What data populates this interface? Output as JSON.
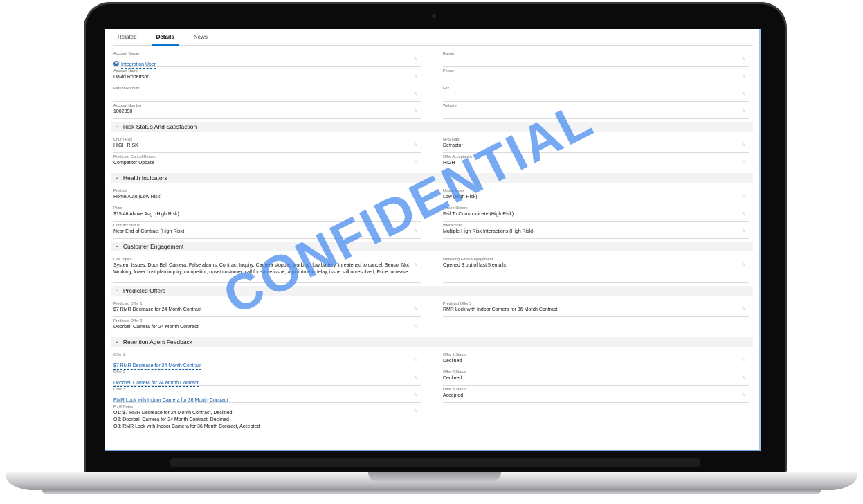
{
  "tabs": [
    {
      "label": "Related"
    },
    {
      "label": "Details"
    },
    {
      "label": "News"
    }
  ],
  "account": {
    "owner_label": "Account Owner",
    "owner_value": "Integration User",
    "rating_label": "Rating",
    "rating_value": "",
    "name_label": "Account Name",
    "name_value": "David Robertson",
    "phone_label": "Phone",
    "phone_value": "",
    "parent_label": "Parent Account",
    "parent_value": "",
    "fax_label": "Fax",
    "fax_value": "",
    "number_label": "Account Number",
    "number_value": "1002898",
    "website_label": "Website",
    "website_value": ""
  },
  "risk": {
    "title": "Risk Status And Satisfaction",
    "churn_label": "Churn Risk",
    "churn_value": "HIGH RISK",
    "nps_label": "NPS Flag",
    "nps_value": "Detractor",
    "cancel_label": "Predicted Cancel Reason",
    "cancel_value": "Competitor Update",
    "offer_label": "Offer Acceptance",
    "offer_value": "HIGH"
  },
  "health": {
    "title": "Health Indicators",
    "product_label": "Product",
    "product_value": "Home Auto (Low Risk)",
    "usage_label": "Usage Index",
    "usage_value": "Low (High Risk)",
    "price_label": "Price",
    "price_value": "$15.46 Above Avg. (High Risk)",
    "history_label": "Tenure History",
    "history_value": "Fail To Communicate (High Risk)",
    "contract_label": "Contract Status",
    "contract_value": "Near End of Contract (High Risk)",
    "interactions_label": "Interactions",
    "interactions_value": "Multiple High Risk Interactions (High Risk)"
  },
  "engagement": {
    "title": "Customer Engagement",
    "topics_label": "Call Topics",
    "topics_value": "System Issues, Door Bell Camera, False alarms, Contract Inquiry, Camera stopped working, low battery, threatened to cancel, Sensor Not Working, lower cost plan inquiry, competitor, upset customer, call for same issue, appointment delay, issue still unresolved, Price Increase",
    "email_label": "Marketing Email Engagement",
    "email_value": "Opened 3 out of last 5 emails"
  },
  "offers": {
    "title": "Predicted Offers",
    "offer1_label": "Predicted Offer 1",
    "offer1_value": "$7 RMR Decrease for 24 Month Contract",
    "offer3_label": "Predicted Offer 3",
    "offer3_value": "RMR Lock with Indoor Camera for 36 Month Contract",
    "offer2_label": "Predicted Offer 2",
    "offer2_value": "Doorbell Camera for 24 Month Contract"
  },
  "feedback": {
    "title": "Retention Agent Feedback",
    "o1_label": "Offer 1",
    "o1_value": "$7 RMR Decrease for 24 Month Contract",
    "o1s_label": "Offer 1 Status",
    "o1s_value": "Declined",
    "o2_label": "Offer 2",
    "o2_value": "Doorbell Camera for 24 Month Contract",
    "o2s_label": "Offer 2 Status",
    "o2s_value": "Declined",
    "o3_label": "Offer 3",
    "o3_value": "RMR Lock with Indoor Camera for 36 Month Contract",
    "o3s_label": "Offer 3 Status",
    "o3s_value": "Accepted",
    "notes_label": "P / R Notes",
    "notes_line1": "O1: $7 RMR Decrease for 24 Month Contract, Declined",
    "notes_line2": "O2: Doorbell Camera for 24 Month Contract, Declined",
    "notes_line3": "O3: RMR Lock with Indoor Camera for 36 Month Contract, Accepted"
  },
  "watermark": "CONFIDENTIAL",
  "icons": {
    "edit": "pencil-icon",
    "collapse": "chevron-down-icon",
    "owner": "user-avatar-icon"
  },
  "colors": {
    "accent": "#0176d3",
    "link": "#0b5cab",
    "watermark": "#4488ee"
  }
}
